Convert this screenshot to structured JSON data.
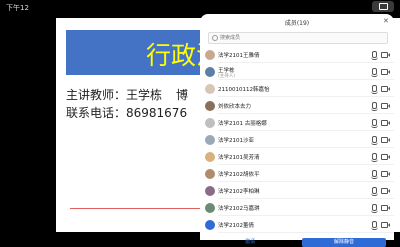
{
  "status": {
    "time": "下午12"
  },
  "slide": {
    "banner_title": "行政法",
    "line1_label": "主讲教师：王学栋",
    "line1_trail": "博",
    "line2": "联系电话：86981676"
  },
  "panel": {
    "title": "成员(19)",
    "close": "✕",
    "search_placeholder": "搜索成员",
    "members": [
      {
        "name": "法学2101王雅倩",
        "sub": "",
        "avatar": "#c9a98e"
      },
      {
        "name": "王学栋",
        "sub": "(主持人)",
        "avatar": "#5d7ea8"
      },
      {
        "name": "2110010112韩嘉怡",
        "sub": "",
        "avatar": "#d6c7b4"
      },
      {
        "name": "刘依欣本去力",
        "sub": "",
        "avatar": "#8a6f5a"
      },
      {
        "name": "法学2101 古丽格娜",
        "sub": "",
        "avatar": "#bfbfbf"
      },
      {
        "name": "法学2101沙亚",
        "sub": "",
        "avatar": "#9aa8b8"
      },
      {
        "name": "法学2101吴芳清",
        "sub": "",
        "avatar": "#d8b27a"
      },
      {
        "name": "法学2102胡依平",
        "sub": "",
        "avatar": "#b28a6c"
      },
      {
        "name": "法学2102李柏琳",
        "sub": "",
        "avatar": "#8b6b8a"
      },
      {
        "name": "法学2102马嘉琪",
        "sub": "",
        "avatar": "#6c8b74"
      },
      {
        "name": "法学2102董倩",
        "sub": "",
        "avatar": "#2f6bd7"
      }
    ],
    "btn_left": "邀请",
    "btn_right": "解除静音"
  }
}
